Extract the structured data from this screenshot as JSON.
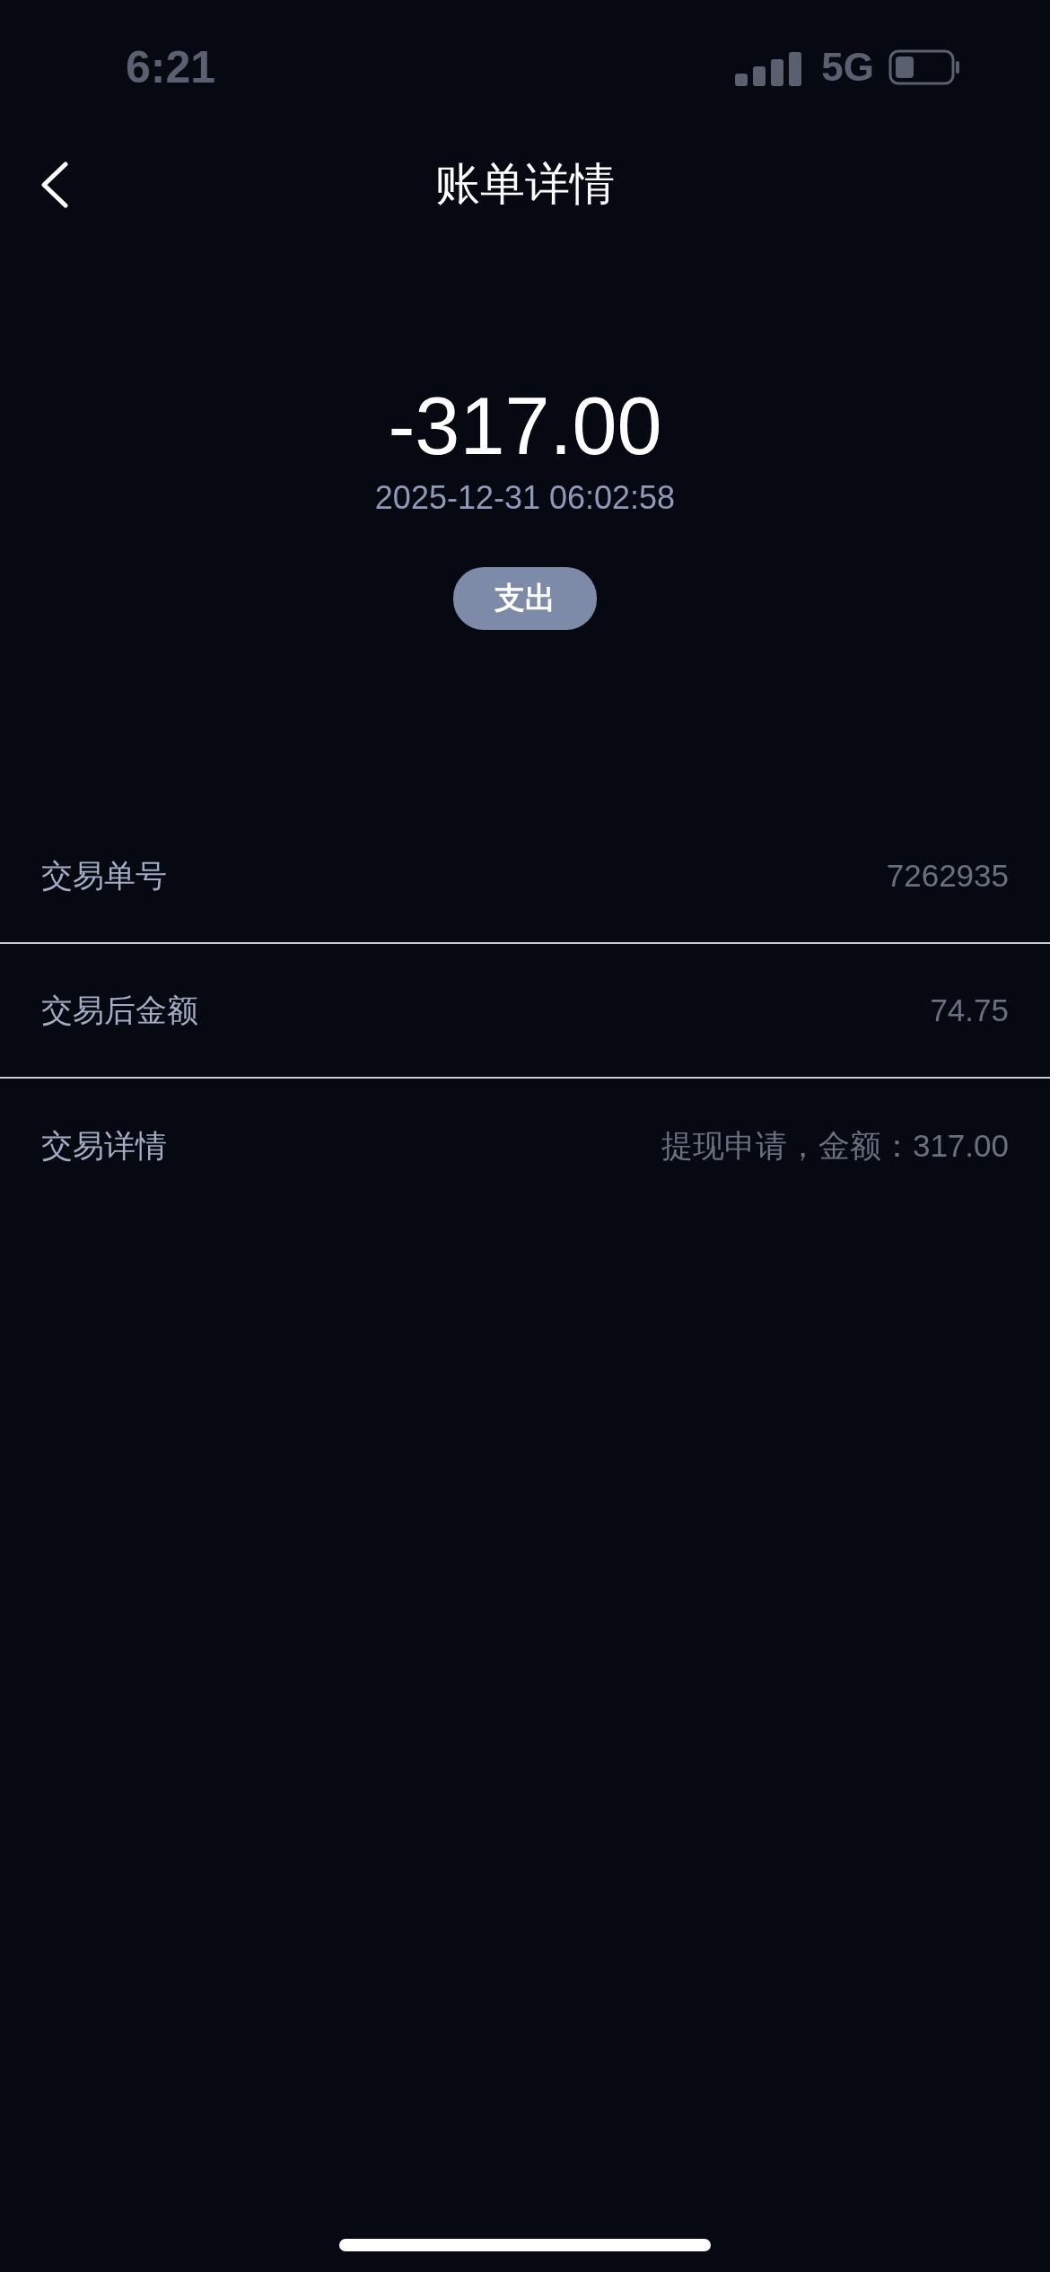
{
  "status_bar": {
    "time": "6:21",
    "network": "5G"
  },
  "header": {
    "title": "账单详情"
  },
  "summary": {
    "amount": "-317.00",
    "datetime": "2025-12-31 06:02:58",
    "type_badge": "支出"
  },
  "rows": [
    {
      "label": "交易单号",
      "value": "7262935"
    },
    {
      "label": "交易后金额",
      "value": "74.75"
    },
    {
      "label": "交易详情",
      "value": "提现申请，金额：317.00"
    }
  ]
}
